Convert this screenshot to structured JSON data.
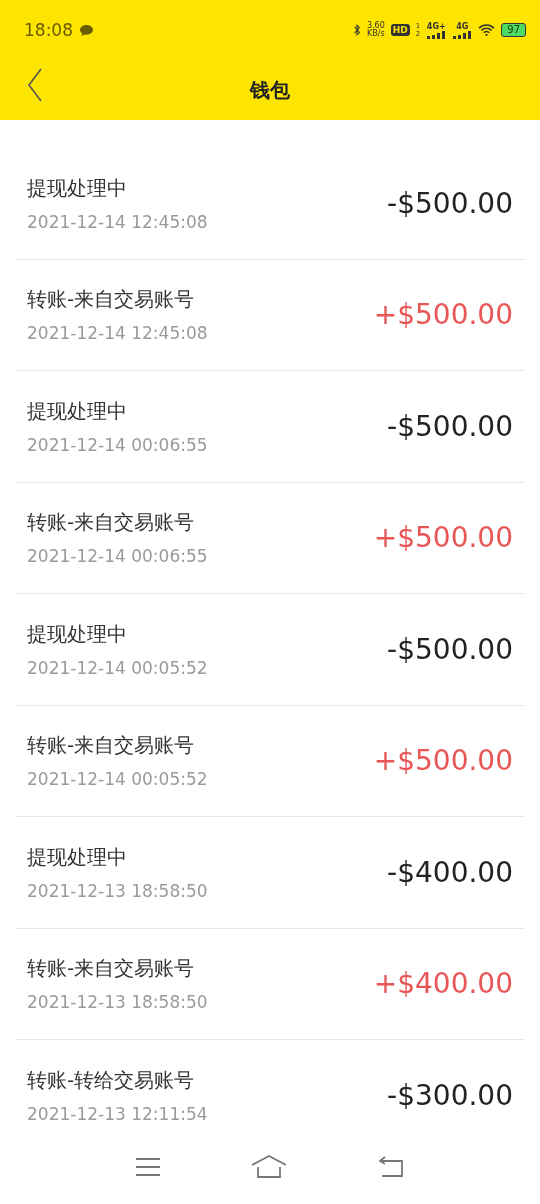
{
  "status_bar": {
    "time": "18:08",
    "speed_value": "3.60",
    "speed_unit": "KB/s",
    "hd": "HD",
    "sim_1": "1",
    "sim_2": "2",
    "network_1": "4G+",
    "network_2": "4G",
    "battery": "97"
  },
  "header": {
    "title": "钱包"
  },
  "transactions": [
    {
      "title": "提现处理中",
      "time": "2021-12-14 12:45:08",
      "amount": "-$500.00",
      "kind": "debit"
    },
    {
      "title": "转账-来自交易账号",
      "time": "2021-12-14 12:45:08",
      "amount": "+$500.00",
      "kind": "credit"
    },
    {
      "title": "提现处理中",
      "time": "2021-12-14 00:06:55",
      "amount": "-$500.00",
      "kind": "debit"
    },
    {
      "title": "转账-来自交易账号",
      "time": "2021-12-14 00:06:55",
      "amount": "+$500.00",
      "kind": "credit"
    },
    {
      "title": "提现处理中",
      "time": "2021-12-14 00:05:52",
      "amount": "-$500.00",
      "kind": "debit"
    },
    {
      "title": "转账-来自交易账号",
      "time": "2021-12-14 00:05:52",
      "amount": "+$500.00",
      "kind": "credit"
    },
    {
      "title": "提现处理中",
      "time": "2021-12-13 18:58:50",
      "amount": "-$400.00",
      "kind": "debit"
    },
    {
      "title": "转账-来自交易账号",
      "time": "2021-12-13 18:58:50",
      "amount": "+$400.00",
      "kind": "credit"
    },
    {
      "title": "转账-转给交易账号",
      "time": "2021-12-13 12:11:54",
      "amount": "-$300.00",
      "kind": "debit"
    }
  ]
}
